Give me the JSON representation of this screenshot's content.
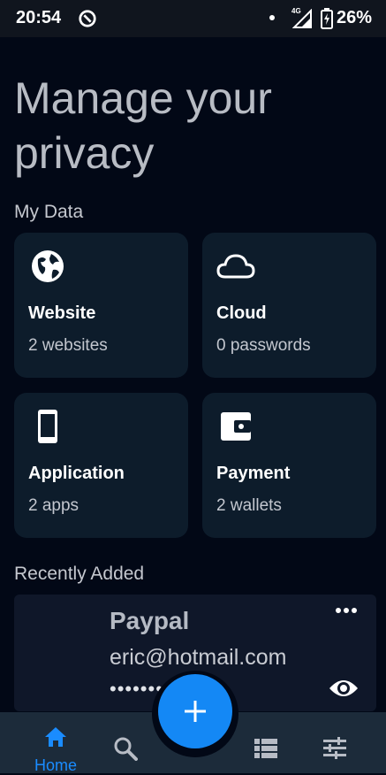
{
  "status_bar": {
    "time": "20:54",
    "network": "4G",
    "battery": "26%"
  },
  "title": "Manage your privacy",
  "my_data": {
    "label": "My Data",
    "cards": [
      {
        "icon": "globe-icon",
        "title": "Website",
        "subtitle": "2 websites"
      },
      {
        "icon": "cloud-icon",
        "title": "Cloud",
        "subtitle": "0 passwords"
      },
      {
        "icon": "phone-icon",
        "title": "Application",
        "subtitle": "2 apps"
      },
      {
        "icon": "wallet-icon",
        "title": "Payment",
        "subtitle": "2 wallets"
      }
    ]
  },
  "recent": {
    "label": "Recently Added",
    "item": {
      "name": "Paypal",
      "email": "eric@hotmail.com",
      "password_masked": "••••••••"
    }
  },
  "nav": {
    "home_label": "Home",
    "active_color": "#1a8cff",
    "items": [
      "home-icon",
      "search-icon",
      "list-icon",
      "tune-icon"
    ]
  },
  "fab": {
    "icon": "plus-icon",
    "color": "#1488f5"
  }
}
